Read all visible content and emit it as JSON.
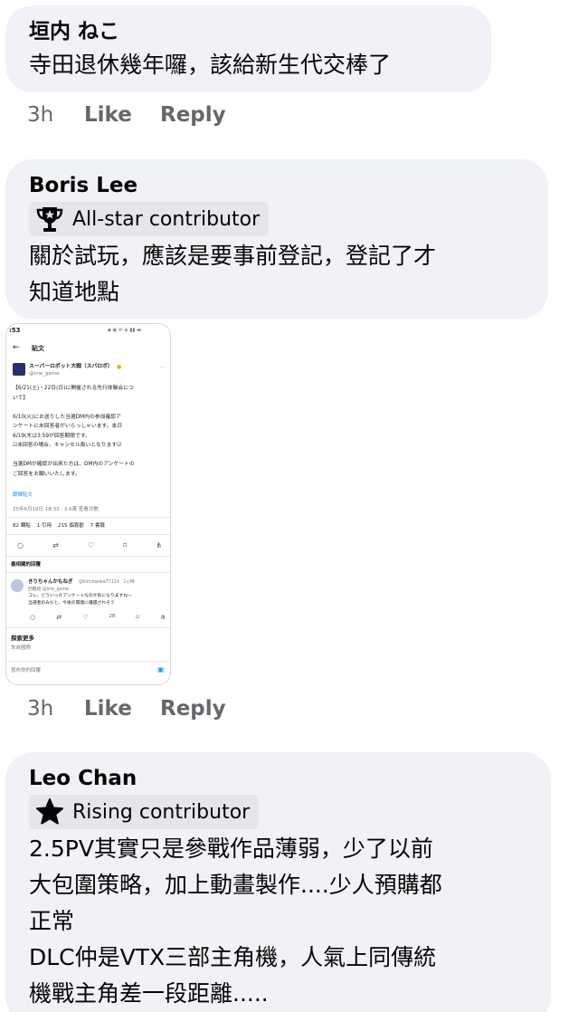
{
  "comments": [
    {
      "author": "垣内 ねこ",
      "text": "寺田退休幾年囉，該給新生代交棒了",
      "time": "3h",
      "like": "Like",
      "reply": "Reply"
    },
    {
      "author": "Boris Lee",
      "badge": "All-star contributor",
      "badge_icon": "trophy-icon",
      "text": "關於試玩，應該是要事前登記，登記了才\n知道地點",
      "time": "3h",
      "like": "Like",
      "reply": "Reply",
      "attachment": {
        "status_time": ":53",
        "header": "貼文",
        "account_name": "スーパーロボット大戦（スパロボ）",
        "account_handle": "@srw_game",
        "post_lines": [
          "【6/21(土)・22日(日)に開催される先行体験会につ",
          "いて】",
          "",
          "6/10(火)にお送りした当選DM内の参加確認ア",
          "ンケートに未回答者がいらっしゃいます。本日",
          "6/19(木)23:59が回答期限です。",
          "☑未回答の場合、キャンセル扱いとなります☑",
          "",
          "当選DMが確認が出来た方は、DM内のアンケートの",
          "ご回答をお願いいたします。"
        ],
        "translate": "翻譯貼文",
        "meta": "25年6月19日 18:32 · 3.6萬 查看次數",
        "stats": [
          "82 轉貼",
          "1 引用",
          "215 個喜歡",
          "7 書籤"
        ],
        "sort_label": "最相關的回覆",
        "reply_name": "きりちゃんかもねぎ",
        "reply_handle": "@kirichanka77110 · 1小時",
        "reply_to": "回覆給 @srw_game",
        "reply_lines": [
          "コレ、どういったアンケートなのか気になりますねー",
          "当選者のみだと、今後の開発に優遇されそう"
        ],
        "reply_views": "28",
        "explore": "探索更多",
        "explore_sub": "來自國際",
        "compose": "發布你的回覆"
      }
    },
    {
      "author": "Leo Chan",
      "badge": "Rising contributor",
      "badge_icon": "star-icon",
      "text": "2.5PV其實只是參戰作品薄弱，少了以前\n大包圍策略，加上動畫製作....少人預購都\n正常\nDLC仲是VTX三部主角機，人氣上同傳統\n機戰主角差一段距離....."
    }
  ],
  "colors": {
    "bubble": "#f0f2f5",
    "badge": "#e4e6eb",
    "meta_text": "#65676b",
    "link": "#1d9bf0"
  }
}
